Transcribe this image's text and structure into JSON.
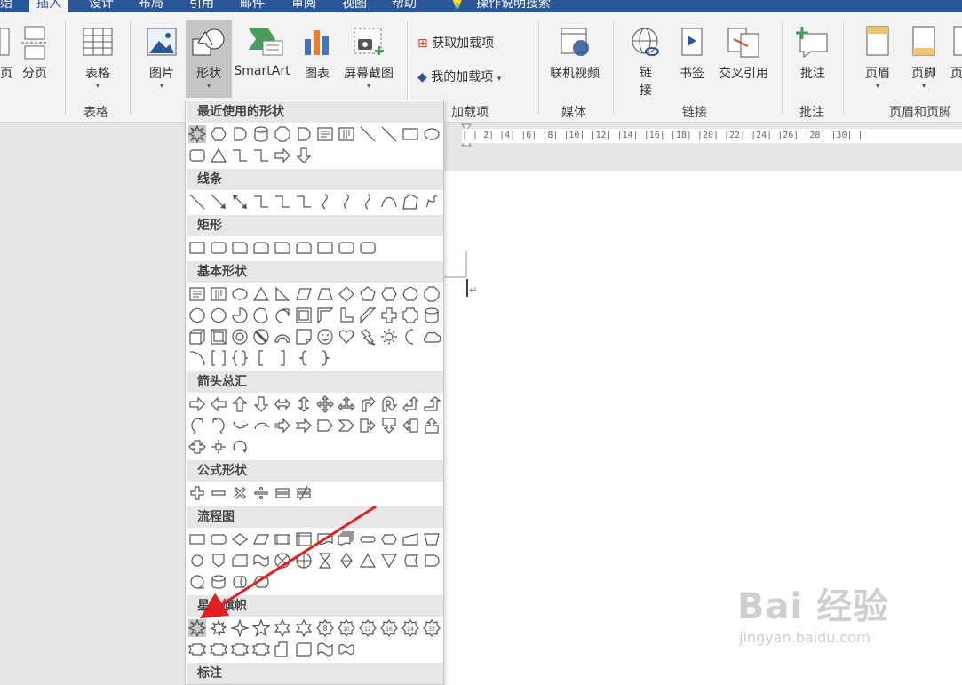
{
  "tabs": [
    {
      "label": "始",
      "active": false
    },
    {
      "label": "插入",
      "active": true
    },
    {
      "label": "设计",
      "active": false
    },
    {
      "label": "布局",
      "active": false
    },
    {
      "label": "引用",
      "active": false
    },
    {
      "label": "邮件",
      "active": false
    },
    {
      "label": "审阅",
      "active": false
    },
    {
      "label": "视图",
      "active": false
    },
    {
      "label": "帮助",
      "active": false
    }
  ],
  "tell_me": "操作说明搜索",
  "ribbon": {
    "page_label": "页",
    "break_label": "分页",
    "table_label": "表格",
    "picture_label": "图片",
    "shapes_label": "形状",
    "smartart_label": "SmartArt",
    "chart_label": "图表",
    "screenshot_label": "屏幕截图",
    "get_addins_label": "获取加载项",
    "my_addins_label": "我的加载项",
    "online_video_label": "联机视频",
    "link_label": "链接",
    "bookmark_label": "书签",
    "crossref_label": "交叉引用",
    "comment_label": "批注",
    "header_label": "页眉",
    "footer_label": "页脚",
    "more_label": "页"
  },
  "groups": {
    "tables": "表格",
    "addins": "加载项",
    "media": "媒体",
    "links": "链接",
    "comments": "批注",
    "header_footer": "页眉和页脚"
  },
  "ruler_text": "|   |  2|  |4|  |6|  |8|  |10|  |12|  |14|  |16|  |18|  |20|  |22|  |24|  |26|  |28|  |30|  |",
  "shapes_menu": {
    "sections": [
      {
        "title": "最近使用的形状"
      },
      {
        "title": "线条"
      },
      {
        "title": "矩形"
      },
      {
        "title": "基本形状"
      },
      {
        "title": "箭头总汇"
      },
      {
        "title": "公式形状"
      },
      {
        "title": "流程图"
      },
      {
        "title": "星与旗帜"
      },
      {
        "title": "标注"
      }
    ]
  },
  "watermark": {
    "main": "Bai 经验",
    "url": "jingyan.baidu.com"
  },
  "colors": {
    "accent": "#2b579a",
    "annotation_arrow": "#e02020"
  }
}
